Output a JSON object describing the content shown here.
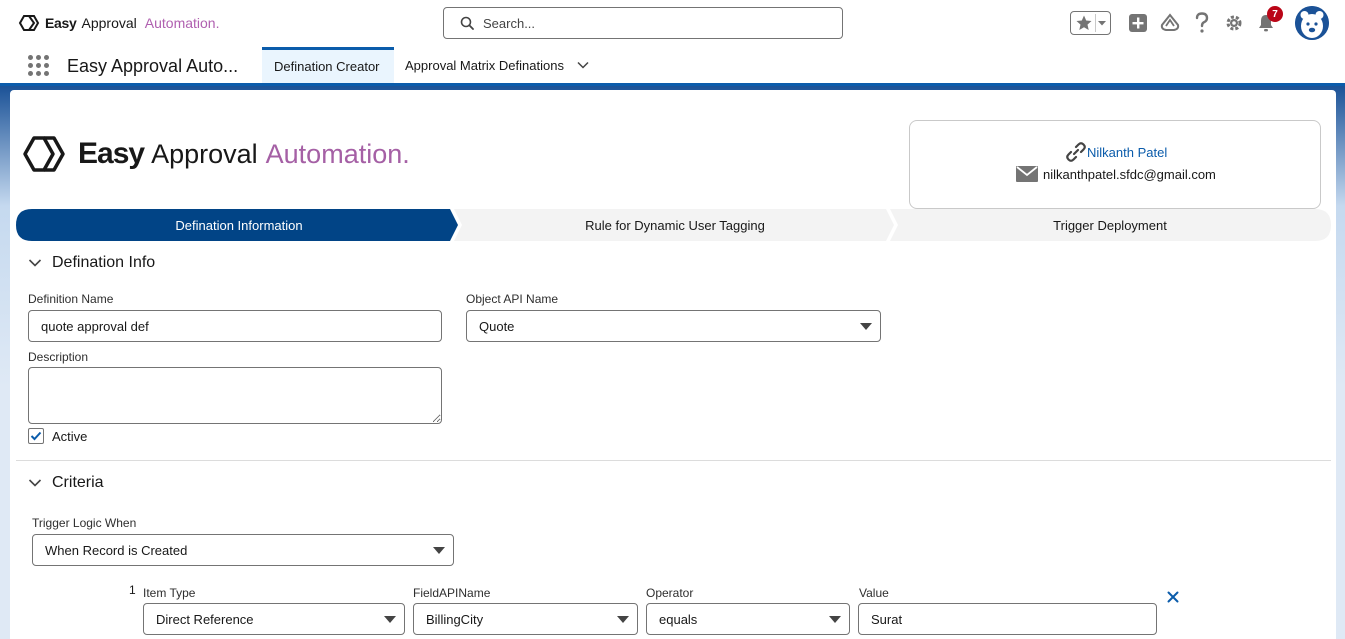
{
  "header": {
    "brand_bold": "Easy",
    "brand_mid": "Approval",
    "brand_accent": "Automation.",
    "search_placeholder": "Search...",
    "notification_count": "7",
    "icons": [
      "star-icon",
      "chevron-down-icon",
      "add-icon",
      "trailhead-icon",
      "help-icon",
      "gear-icon",
      "bell-icon",
      "avatar"
    ]
  },
  "nav": {
    "app_name": "Easy Approval Auto...",
    "tabs": [
      {
        "label": "Defination Creator",
        "active": true
      },
      {
        "label": "Approval Matrix Definations",
        "active": false
      }
    ]
  },
  "logo": {
    "bold": "Easy",
    "mid": "Approval",
    "accent": "Automation."
  },
  "contact": {
    "name": "Nilkanth Patel",
    "email": "nilkanthpatel.sfdc@gmail.com"
  },
  "path": {
    "steps": [
      {
        "label": "Defination Information",
        "active": true
      },
      {
        "label": "Rule for Dynamic User Tagging",
        "active": false
      },
      {
        "label": "Trigger Deployment",
        "active": false
      }
    ]
  },
  "defination_info": {
    "title": "Defination Info",
    "definition_name_label": "Definition Name",
    "definition_name_value": "quote approval def",
    "object_api_label": "Object API Name",
    "object_api_value": "Quote",
    "description_label": "Description",
    "description_value": "",
    "active_label": "Active",
    "active_checked": true
  },
  "criteria": {
    "title": "Criteria",
    "trigger_logic_label": "Trigger Logic When",
    "trigger_logic_value": "When Record is Created",
    "rows": [
      {
        "num": "1",
        "item_type_label": "Item Type",
        "item_type_value": "Direct Reference",
        "field_label": "FieldAPIName",
        "field_value": "BillingCity",
        "operator_label": "Operator",
        "operator_value": "equals",
        "value_label": "Value",
        "value_value": "Surat"
      }
    ]
  },
  "colors": {
    "brand_blue": "#0b5cab",
    "path_active": "#014486",
    "accent_purple": "#a560a5",
    "badge_red": "#ba0517"
  }
}
